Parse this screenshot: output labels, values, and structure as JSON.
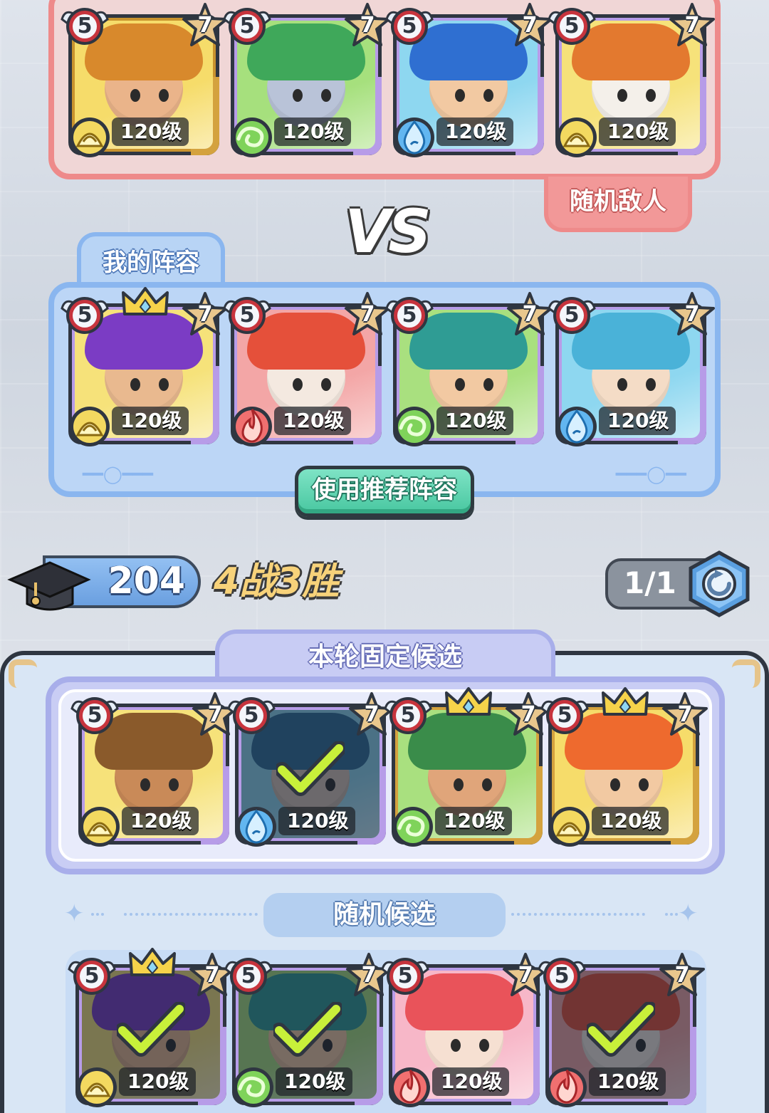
{
  "enemy": {
    "tag": "随机敌人",
    "heroes": [
      {
        "stage": "5",
        "stars": "7",
        "level": "120级",
        "element": "earth-icon",
        "crown": false,
        "selected": false,
        "bg": "#f6dc6a",
        "frame": "#c9932e",
        "hair": "#d8892c",
        "skin": "#eab48a",
        "strip": "#d4a23e"
      },
      {
        "stage": "5",
        "stars": "7",
        "level": "120级",
        "element": "wind-icon",
        "crown": false,
        "selected": false,
        "bg": "#a6e07d",
        "frame": "#b79ce8",
        "hair": "#3fa85a",
        "skin": "#b9c3d8",
        "strip": "#b79ce8"
      },
      {
        "stage": "5",
        "stars": "7",
        "level": "120级",
        "element": "water-icon",
        "crown": false,
        "selected": false,
        "bg": "#8ed7f0",
        "frame": "#b79ce8",
        "hair": "#2f6fd1",
        "skin": "#f2c9a2",
        "strip": "#b79ce8"
      },
      {
        "stage": "5",
        "stars": "7",
        "level": "120级",
        "element": "earth-icon",
        "crown": false,
        "selected": false,
        "bg": "#f6e27a",
        "frame": "#b79ce8",
        "hair": "#e3792f",
        "skin": "#f4f0ea",
        "strip": "#b79ce8"
      }
    ]
  },
  "vs_label": "VS",
  "my_lineup": {
    "tag": "我的阵容",
    "recommend_button": "使用推荐阵容",
    "heroes": [
      {
        "stage": "5",
        "stars": "7",
        "level": "120级",
        "element": "earth-icon",
        "crown": true,
        "selected": false,
        "bg": "#f6e27a",
        "frame": "#b79ce8",
        "hair": "#7b3cc4",
        "skin": "#e9b98f",
        "strip": "#b79ce8"
      },
      {
        "stage": "5",
        "stars": "7",
        "level": "120级",
        "element": "fire-icon",
        "crown": false,
        "selected": false,
        "bg": "#f3a6a6",
        "frame": "#b79ce8",
        "hair": "#e5503a",
        "skin": "#f4e9e0",
        "strip": "#b79ce8"
      },
      {
        "stage": "5",
        "stars": "7",
        "level": "120级",
        "element": "wind-icon",
        "crown": false,
        "selected": false,
        "bg": "#a9e07f",
        "frame": "#b79ce8",
        "hair": "#2f9c94",
        "skin": "#f2c9a2",
        "strip": "#b79ce8"
      },
      {
        "stage": "5",
        "stars": "7",
        "level": "120级",
        "element": "water-icon",
        "crown": false,
        "selected": false,
        "bg": "#8ed7f0",
        "frame": "#b79ce8",
        "hair": "#4ab2d8",
        "skin": "#f4dcc6",
        "strip": "#b79ce8"
      }
    ]
  },
  "stats": {
    "score": "204",
    "record": "4战3胜",
    "refresh_count": "1/1"
  },
  "fixed_candidates": {
    "title": "本轮固定候选",
    "heroes": [
      {
        "stage": "5",
        "stars": "7",
        "level": "120级",
        "element": "earth-icon",
        "crown": false,
        "selected": false,
        "bg": "#f6e27a",
        "frame": "#b79ce8",
        "hair": "#8a5a2b",
        "skin": "#c98a58",
        "strip": "#b79ce8"
      },
      {
        "stage": "5",
        "stars": "7",
        "level": "120级",
        "element": "water-icon",
        "crown": false,
        "selected": true,
        "bg": "#8ed7f0",
        "frame": "#b79ce8",
        "hair": "#2f6f9a",
        "skin": "#d8c6b8",
        "strip": "#b79ce8"
      },
      {
        "stage": "5",
        "stars": "7",
        "level": "120级",
        "element": "wind-icon",
        "crown": true,
        "selected": false,
        "bg": "#a9e07f",
        "frame": "#d4a23e",
        "hair": "#3a8c4a",
        "skin": "#e0a57a",
        "strip": "#d4a23e"
      },
      {
        "stage": "5",
        "stars": "7",
        "level": "120级",
        "element": "earth-icon",
        "crown": true,
        "selected": false,
        "bg": "#f6dc6a",
        "frame": "#d4a23e",
        "hair": "#ee6a2e",
        "skin": "#f2c9a2",
        "strip": "#d4a23e"
      }
    ]
  },
  "random_candidates": {
    "title": "随机候选",
    "heroes": [
      {
        "stage": "5",
        "stars": "7",
        "level": "120级",
        "element": "earth-icon",
        "crown": true,
        "selected": true,
        "bg": "#f6e27a",
        "frame": "#b79ce8",
        "hair": "#7b3cc4",
        "skin": "#e9b98f",
        "strip": "#b79ce8"
      },
      {
        "stage": "5",
        "stars": "7",
        "level": "120级",
        "element": "wind-icon",
        "crown": false,
        "selected": true,
        "bg": "#a9e07f",
        "frame": "#b79ce8",
        "hair": "#2f9c94",
        "skin": "#f2c9a2",
        "strip": "#b79ce8"
      },
      {
        "stage": "5",
        "stars": "7",
        "level": "120级",
        "element": "fire-icon",
        "crown": false,
        "selected": false,
        "bg": "#f7b7c8",
        "frame": "#b79ce8",
        "hair": "#e9535a",
        "skin": "#f6e0d2",
        "strip": "#b79ce8"
      },
      {
        "stage": "5",
        "stars": "7",
        "level": "120级",
        "element": "fire-icon",
        "crown": false,
        "selected": true,
        "bg": "#f3a6a6",
        "frame": "#b79ce8",
        "hair": "#e5503a",
        "skin": "#f4e9e0",
        "strip": "#b79ce8"
      }
    ]
  },
  "colors": {
    "enemy_border": "#ee8a8a",
    "my_border": "#8ab6ef",
    "fixed_border": "#a8aeea",
    "button_green": "#48c7a0",
    "record_gold": "#f7d27a"
  }
}
